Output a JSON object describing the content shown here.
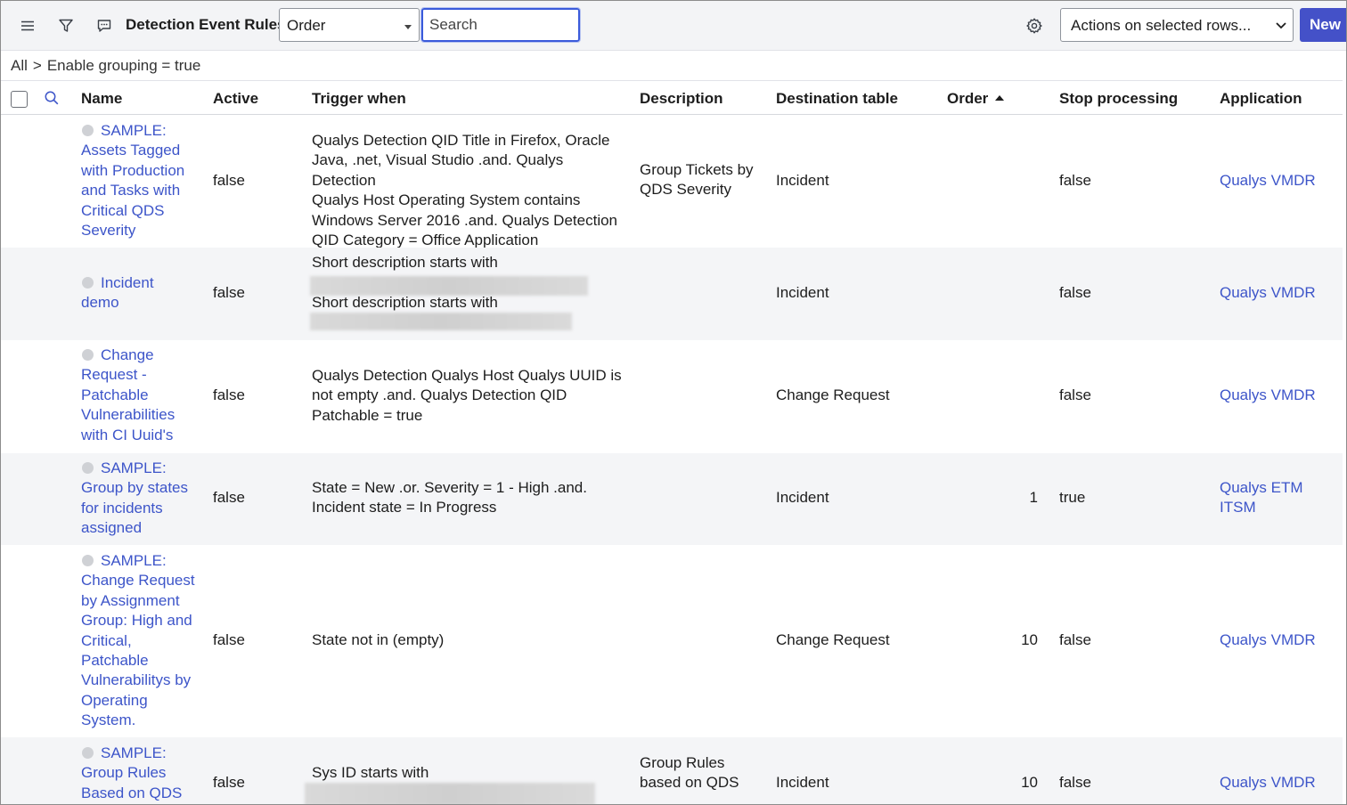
{
  "header": {
    "title": "Detection Event Rules",
    "order_select": "Order",
    "search_placeholder": "Search",
    "actions_select": "Actions on selected rows...",
    "new_label": "New"
  },
  "breadcrumb": {
    "root": "All",
    "separator": ">",
    "filter": "Enable grouping = true"
  },
  "columns": {
    "name": "Name",
    "active": "Active",
    "trigger": "Trigger when",
    "description": "Description",
    "destination": "Destination table",
    "order": "Order",
    "stop": "Stop processing",
    "application": "Application"
  },
  "rows": [
    {
      "name_lines": [
        "SAMPLE:",
        "Assets Tagged",
        "with Production",
        "and Tasks with",
        "Critical QDS",
        "Severity"
      ],
      "active": "false",
      "trigger_lines": [
        "Qualys Detection QID Title in Firefox, Oracle",
        "Java, .net, Visual Studio .and. Qualys Detection",
        "Qualys Host Operating System contains",
        "Windows Server 2016 .and. Qualys Detection",
        "QID Category = Office Application"
      ],
      "description_lines": [
        "Group Tickets by",
        "QDS Severity"
      ],
      "destination": "Incident",
      "order": "",
      "stop": "false",
      "application_lines": [
        "Qualys VMDR"
      ]
    },
    {
      "name_lines": [
        "Incident",
        "demo"
      ],
      "active": "false",
      "trigger_lines": [
        "Short description starts with",
        "Short description starts with"
      ],
      "description_lines": [],
      "destination": "Incident",
      "order": "",
      "stop": "false",
      "application_lines": [
        "Qualys VMDR"
      ]
    },
    {
      "name_lines": [
        "Change",
        "Request -",
        "Patchable",
        "Vulnerabilities",
        "with CI Uuid's"
      ],
      "active": "false",
      "trigger_lines": [
        "Qualys Detection Qualys Host Qualys UUID is",
        "not empty .and. Qualys Detection QID",
        "Patchable = true"
      ],
      "description_lines": [],
      "destination": "Change Request",
      "order": "",
      "stop": "false",
      "application_lines": [
        "Qualys VMDR"
      ]
    },
    {
      "name_lines": [
        "SAMPLE:",
        "Group by states",
        "for incidents",
        "assigned"
      ],
      "active": "false",
      "trigger_lines": [
        "State = New .or. Severity = 1 - High .and.",
        "Incident state = In Progress"
      ],
      "description_lines": [],
      "destination": "Incident",
      "order": "1",
      "stop": "true",
      "application_lines": [
        "Qualys ETM",
        "ITSM"
      ]
    },
    {
      "name_lines": [
        "SAMPLE:",
        "Change Request",
        "by Assignment",
        "Group: High and",
        "Critical,",
        "Patchable",
        "Vulnerabilitys by",
        "Operating",
        "System."
      ],
      "active": "false",
      "trigger_lines": [
        "State not in (empty)"
      ],
      "description_lines": [],
      "destination": "Change Request",
      "order": "10",
      "stop": "false",
      "application_lines": [
        "Qualys VMDR"
      ]
    },
    {
      "name_lines": [
        "SAMPLE:",
        "Group Rules",
        "Based on QDS"
      ],
      "active": "false",
      "trigger_lines": [
        "Sys ID starts with"
      ],
      "description_lines": [
        "Group Rules",
        "based on QDS"
      ],
      "destination": "Incident",
      "order": "10",
      "stop": "false",
      "application_lines": [
        "Qualys VMDR"
      ]
    }
  ],
  "icons": {
    "menu": "hamburger-menu-icon",
    "filter": "filter-icon",
    "comment": "comment-icon",
    "settings": "gear-icon",
    "column_search": "search-icon",
    "row_status": "status-dot-icon"
  },
  "colors": {
    "link": "#3d55c9",
    "primary_button": "#4451c8",
    "header_bg": "#f3f4f6",
    "alt_row_bg": "#f4f5f7"
  }
}
